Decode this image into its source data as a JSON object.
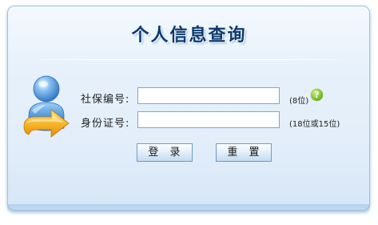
{
  "title": "个人信息查询",
  "fields": {
    "ssn": {
      "label": "社保编号:",
      "value": "",
      "hint": "(8位)"
    },
    "id_card": {
      "label": "身份证号:",
      "value": "",
      "hint": "(18位或15位)"
    }
  },
  "help_icon": {
    "glyph": "?",
    "icon": "help-circle-icon",
    "color": "#7cc32a"
  },
  "buttons": {
    "login": "登 录",
    "reset": "重 置"
  },
  "colors": {
    "title": "#0c3a6b",
    "panel_border": "#9cc3e4",
    "input_border": "#7fa6cc",
    "arrow": "#f3a21a",
    "avatar": "#3e86d1"
  }
}
